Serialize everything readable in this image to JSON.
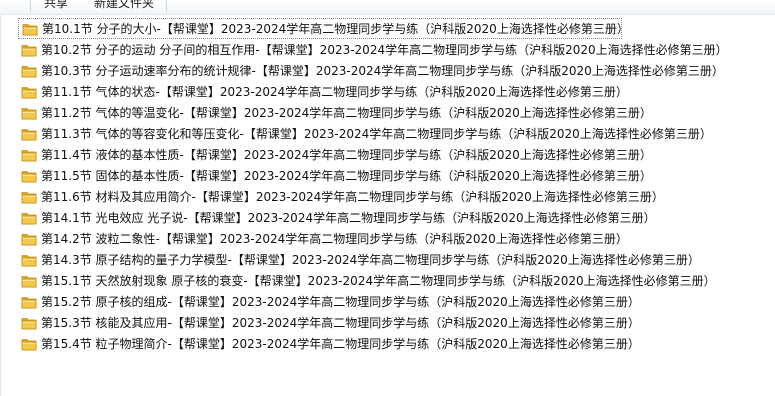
{
  "toolbar": {
    "share_label": "共享",
    "new_folder_label": "新建文件夹"
  },
  "folders": [
    {
      "name": "第10.1节 分子的大小-【帮课堂】2023-2024学年高二物理同步学与练（沪科版2020上海选择性必修第三册）",
      "selected": true
    },
    {
      "name": "第10.2节 分子的运动 分子间的相互作用-【帮课堂】2023-2024学年高二物理同步学与练（沪科版2020上海选择性必修第三册）"
    },
    {
      "name": "第10.3节 分子运动速率分布的统计规律-【帮课堂】2023-2024学年高二物理同步学与练（沪科版2020上海选择性必修第三册）"
    },
    {
      "name": "第11.1节 气体的状态-【帮课堂】2023-2024学年高二物理同步学与练（沪科版2020上海选择性必修第三册）"
    },
    {
      "name": "第11.2节 气体的等温变化-【帮课堂】2023-2024学年高二物理同步学与练（沪科版2020上海选择性必修第三册）"
    },
    {
      "name": "第11.3节 气体的等容变化和等压变化-【帮课堂】2023-2024学年高二物理同步学与练（沪科版2020上海选择性必修第三册）"
    },
    {
      "name": "第11.4节 液体的基本性质-【帮课堂】2023-2024学年高二物理同步学与练（沪科版2020上海选择性必修第三册）"
    },
    {
      "name": "第11.5节 固体的基本性质-【帮课堂】2023-2024学年高二物理同步学与练（沪科版2020上海选择性必修第三册）"
    },
    {
      "name": "第11.6节 材料及其应用简介-【帮课堂】2023-2024学年高二物理同步学与练（沪科版2020上海选择性必修第三册）"
    },
    {
      "name": "第14.1节 光电效应 光子说-【帮课堂】2023-2024学年高二物理同步学与练（沪科版2020上海选择性必修第三册）"
    },
    {
      "name": "第14.2节 波粒二象性-【帮课堂】2023-2024学年高二物理同步学与练（沪科版2020上海选择性必修第三册）"
    },
    {
      "name": "第14.3节 原子结构的量子力学模型-【帮课堂】2023-2024学年高二物理同步学与练（沪科版2020上海选择性必修第三册）"
    },
    {
      "name": "第15.1节 天然放射现象 原子核的衰变-【帮课堂】2023-2024学年高二物理同步学与练（沪科版2020上海选择性必修第三册）"
    },
    {
      "name": "第15.2节 原子核的组成-【帮课堂】2023-2024学年高二物理同步学与练（沪科版2020上海选择性必修第三册）"
    },
    {
      "name": "第15.3节 核能及其应用-【帮课堂】2023-2024学年高二物理同步学与练（沪科版2020上海选择性必修第三册）"
    },
    {
      "name": "第15.4节 粒子物理简介-【帮课堂】2023-2024学年高二物理同步学与练（沪科版2020上海选择性必修第三册）"
    }
  ],
  "colors": {
    "folder_body": "#f2c94c",
    "folder_tab": "#e0a823",
    "folder_edge": "#c58e12",
    "selection_border": "#7a8aa0"
  },
  "icons": {
    "folder": "folder-icon"
  }
}
